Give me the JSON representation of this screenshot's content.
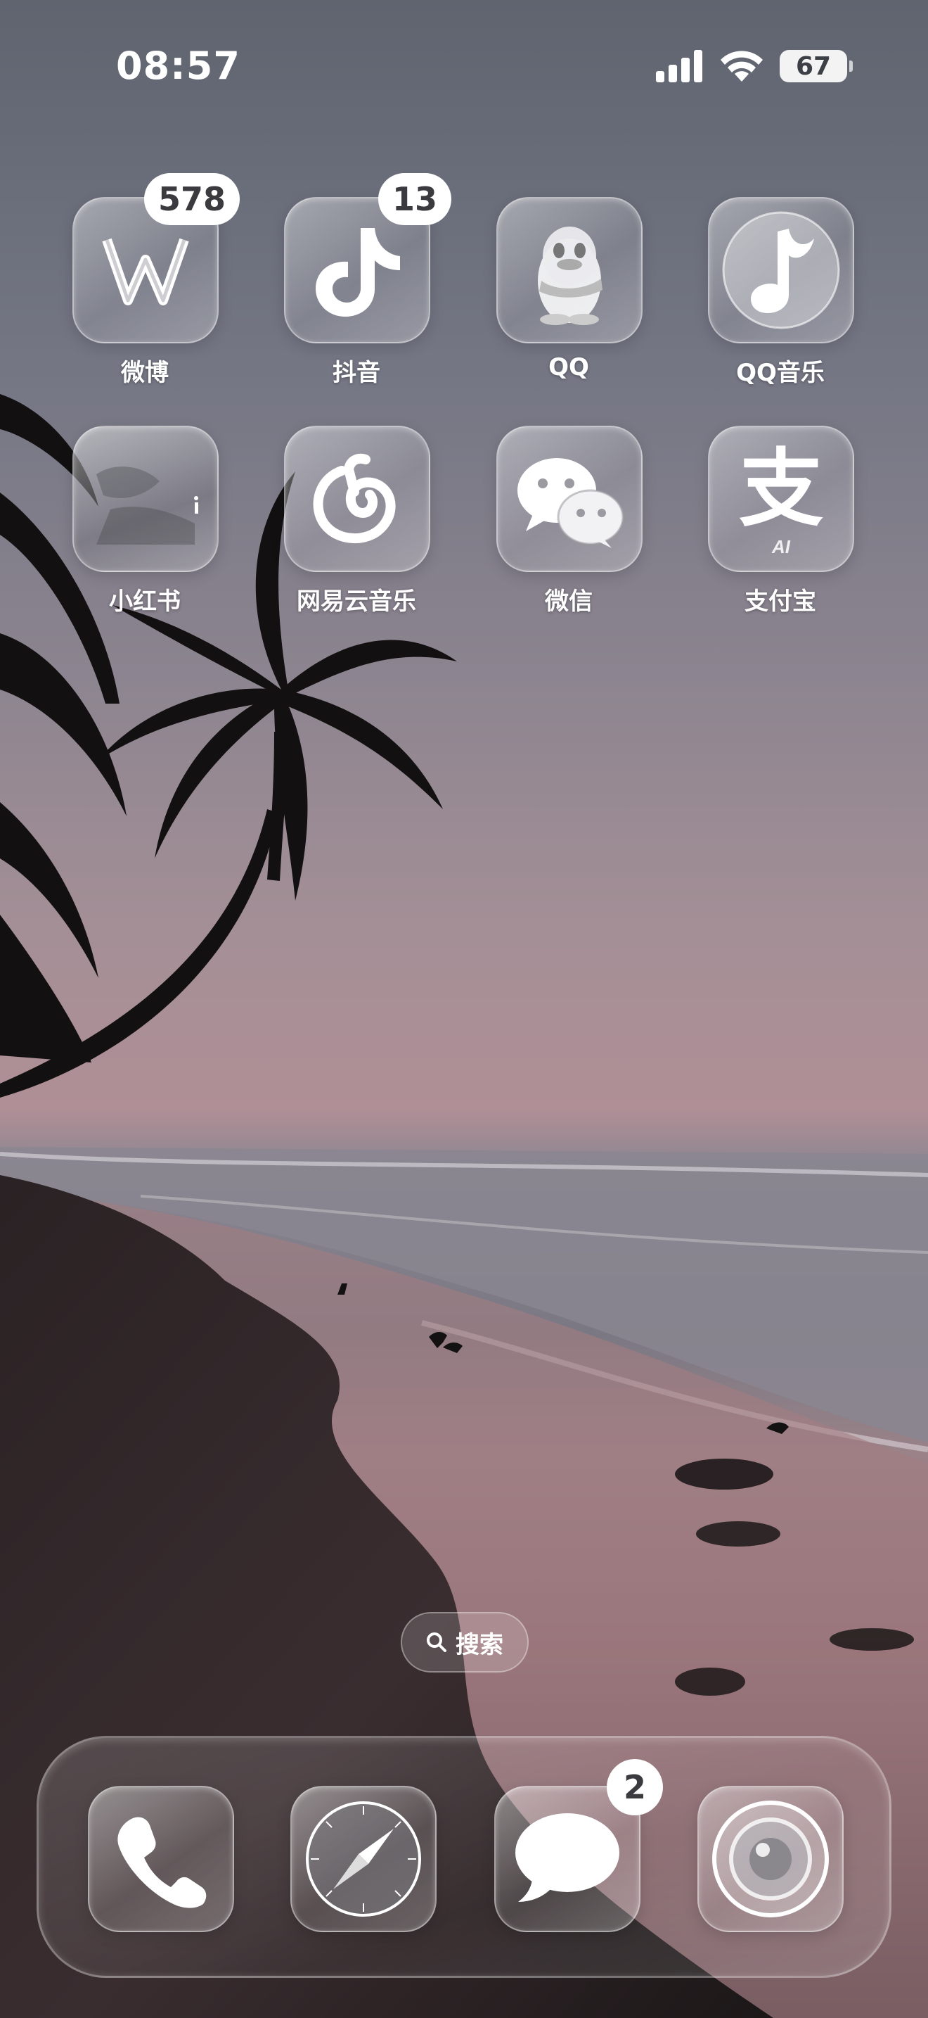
{
  "status_bar": {
    "time": "08:57",
    "battery_level": "67"
  },
  "home_apps": [
    {
      "label": "微博",
      "badge": "578",
      "icon": "weibo-icon"
    },
    {
      "label": "抖音",
      "badge": "13",
      "icon": "douyin-icon"
    },
    {
      "label": "QQ",
      "icon": "qq-penguin-icon"
    },
    {
      "label": "QQ音乐",
      "icon": "qq-music-icon"
    },
    {
      "label": "小红书",
      "icon": "xiaohongshu-icon"
    },
    {
      "label": "网易云音乐",
      "icon": "netease-music-icon"
    },
    {
      "label": "微信",
      "icon": "wechat-icon"
    },
    {
      "label": "支付宝",
      "icon": "alipay-icon",
      "icon_text": "支",
      "icon_subtext": "AI"
    }
  ],
  "search": {
    "label": "搜索"
  },
  "dock": [
    {
      "name": "Phone",
      "icon": "phone-icon"
    },
    {
      "name": "Safari",
      "icon": "safari-compass-icon"
    },
    {
      "name": "Messages",
      "icon": "messages-icon",
      "badge": "2"
    },
    {
      "name": "Camera",
      "icon": "camera-icon"
    }
  ]
}
